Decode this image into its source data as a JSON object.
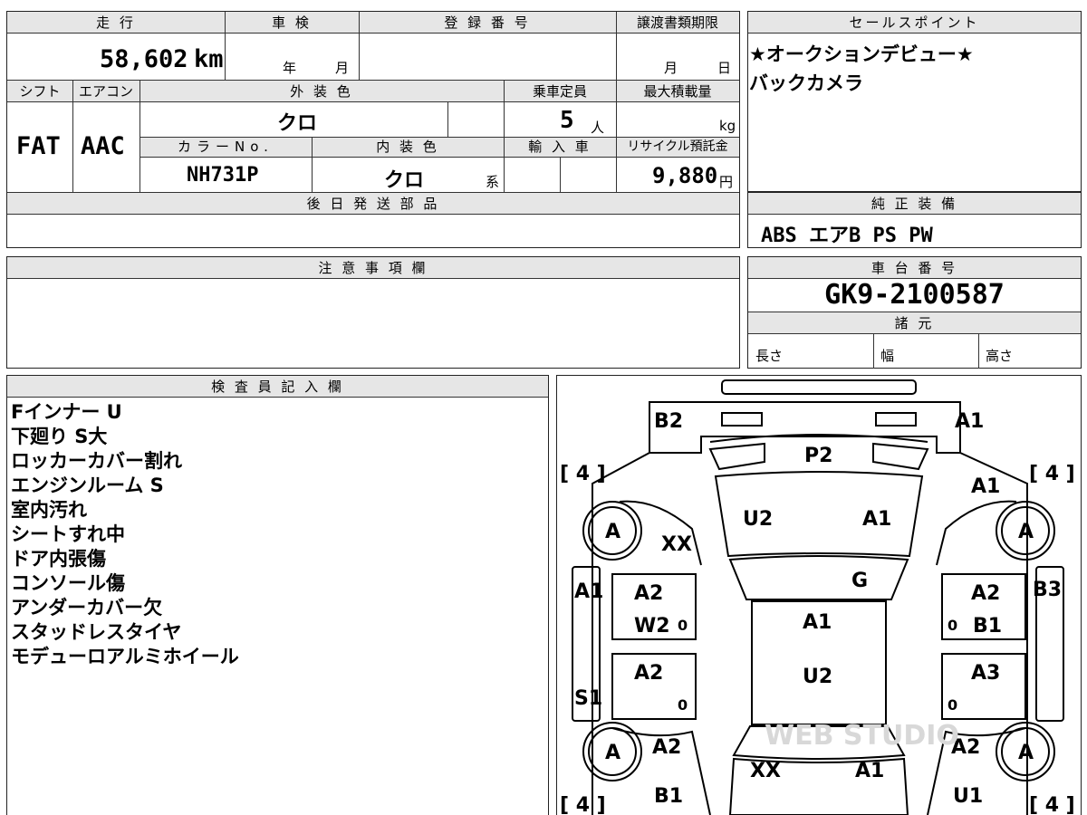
{
  "mileage": {
    "label": "走 行",
    "value": "58,602",
    "unit": "km"
  },
  "inspection": {
    "label": "車 検",
    "year": "年",
    "month": "月"
  },
  "registration": {
    "label": "登 録 番 号"
  },
  "transfer": {
    "label": "譲渡書類期限",
    "month": "月",
    "day": "日"
  },
  "sales_point": {
    "label": "セールスポイント",
    "lines": [
      "★オークションデビュー★",
      "バックカメラ"
    ]
  },
  "shift": {
    "label": "シフト",
    "value": "FAT"
  },
  "aircon": {
    "label": "エアコン",
    "value": "AAC"
  },
  "exterior": {
    "label": "外 装 色",
    "value": "クロ"
  },
  "capacity": {
    "label": "乗車定員",
    "value": "5",
    "unit": "人"
  },
  "max_load": {
    "label": "最大積載量",
    "unit": "kg"
  },
  "color_no": {
    "label": "カラーNo.",
    "value": "NH731P"
  },
  "interior": {
    "label": "内 装 色",
    "value": "クロ",
    "suffix": "系"
  },
  "import": {
    "label": "輸 入 車"
  },
  "recycle": {
    "label": "リサイクル預託金",
    "value": "9,880",
    "unit": "円"
  },
  "later_parts": {
    "label": "後 日 発 送 部 品"
  },
  "genuine": {
    "label": "純 正 装 備",
    "value": "ABS エアB PS PW"
  },
  "caution": {
    "label": "注 意 事 項 欄"
  },
  "chassis": {
    "label": "車 台 番 号",
    "value": "GK9-2100587"
  },
  "specs": {
    "label": "諸 元",
    "length": "長さ",
    "width": "幅",
    "height": "高さ"
  },
  "inspector": {
    "label": "検 査 員 記 入 欄",
    "notes": [
      "Fインナー U",
      "下廻り S大",
      "ロッカーカバー割れ",
      "エンジンルーム S",
      "室内汚れ",
      "シートすれ中",
      "ドア内張傷",
      "コンソール傷",
      "アンダーカバー欠",
      "スタッドレスタイヤ",
      "モデューロアルミホイール"
    ]
  },
  "diagram": {
    "tire_count_tl": "[ 4 ]",
    "tire_count_tr": "[ 4 ]",
    "tire_count_bl": "[ 4 ]",
    "tire_count_br": "[ 4 ]",
    "wheel_tl": "A",
    "wheel_tr": "A",
    "wheel_bl": "A",
    "wheel_br": "A",
    "b2": "B2",
    "a1_front_right": "A1",
    "p2": "P2",
    "a1_right_fender": "A1",
    "u2_hood": "U2",
    "a1_hood": "A1",
    "xx_front_left": "XX",
    "g_windshield": "G",
    "a1_left_pillar": "A1",
    "a2_left_front_door": "A2",
    "w2_left_front_door": "W2",
    "zero1": "0",
    "a1_roof": "A1",
    "zero2": "0",
    "a2_right_front_door": "A2",
    "b1_right_front_door": "B1",
    "b3_right_pillar": "B3",
    "a2_left_rear_door": "A2",
    "u2_roof": "U2",
    "a3_right_rear_door": "A3",
    "s1_left_rocker": "S1",
    "zero3": "0",
    "zero4": "0",
    "a2_left_rear_fender": "A2",
    "xx_trunk": "XX",
    "a1_trunk": "A1",
    "a2_right_rear_fender": "A2",
    "b1_left_rear": "B1",
    "u1_right_rear": "U1",
    "watermark": "WEB STUDIO"
  }
}
